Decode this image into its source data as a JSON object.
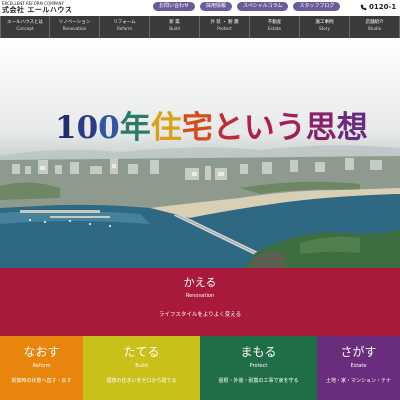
{
  "header": {
    "company_sub": "EXCELLENT REFORM COMPANY",
    "company_name": "式会社 エールハウス",
    "links": [
      "お問い合わせ",
      "採用情報",
      "スペシャルコラム",
      "スタッフブログ"
    ],
    "phone": "0120-1"
  },
  "nav": [
    {
      "ja": "エールハウスとは",
      "en": "Concept"
    },
    {
      "ja": "リノベーション",
      "en": "Renovation"
    },
    {
      "ja": "リフォーム",
      "en": "Reform"
    },
    {
      "ja": "新 築",
      "en": "Build"
    },
    {
      "ja": "外 装 ・ 耐 震",
      "en": "Protect"
    },
    {
      "ja": "不動産",
      "en": "Estate"
    },
    {
      "ja": "施工事例",
      "en": "Story"
    },
    {
      "ja": "店舗紹介",
      "en": "Studio"
    }
  ],
  "hero": {
    "title_chars": [
      {
        "t": "1",
        "color": "#1f2f6e"
      },
      {
        "t": "0",
        "color": "#2b3b8a"
      },
      {
        "t": "0",
        "color": "#2f55a4"
      },
      {
        "t": "年",
        "color": "#2e7a6a"
      },
      {
        "t": "住",
        "color": "#d9a21b"
      },
      {
        "t": "宅",
        "color": "#d64a1d"
      },
      {
        "t": "と",
        "color": "#c22a3a"
      },
      {
        "t": "い",
        "color": "#b21e4c"
      },
      {
        "t": "う",
        "color": "#a0205a"
      },
      {
        "t": "思",
        "color": "#8a2168"
      },
      {
        "t": "想",
        "color": "#6a2a80"
      }
    ]
  },
  "kaeru": {
    "title": "かえる",
    "en": "Renovation",
    "desc": "ライフスタイルをよりよく変える"
  },
  "columns": [
    {
      "title": "なおす",
      "en": "Reform",
      "desc": "新築時の状態へ直す・戻す",
      "color": "#e7850c"
    },
    {
      "title": "たてる",
      "en": "Build",
      "desc": "理想の住まいをゼロから建てる",
      "color": "#c9c01a"
    },
    {
      "title": "まもる",
      "en": "Protect",
      "desc": "屋根・外装・耐震の工事で家を守る",
      "color": "#1f6e48"
    },
    {
      "title": "さがす",
      "en": "Estate",
      "desc": "土地・家・マンション・テナ",
      "color": "#6a2d7e"
    }
  ]
}
